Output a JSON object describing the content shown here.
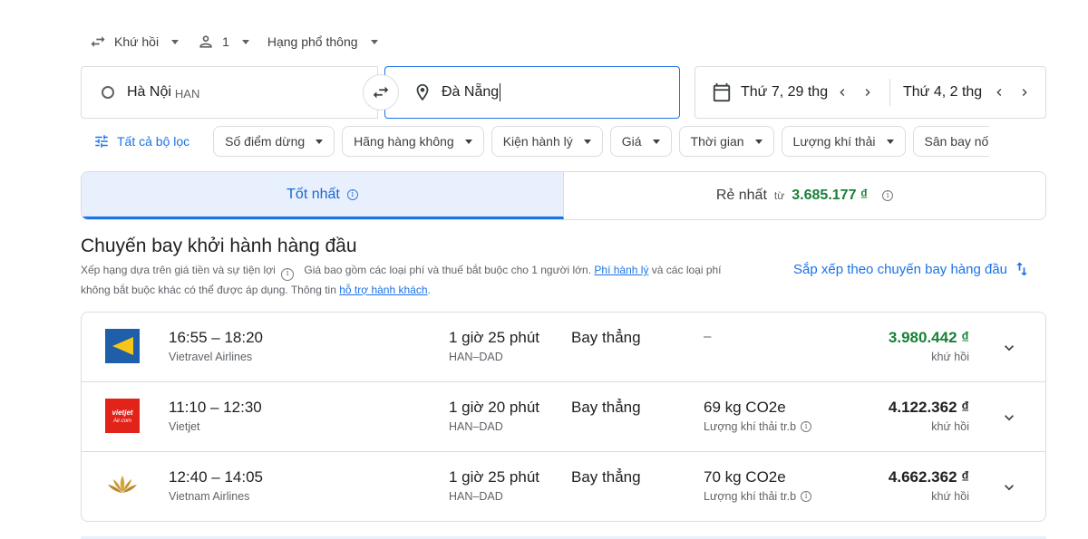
{
  "options": {
    "trip_type": "Khứ hồi",
    "passengers": "1",
    "cabin_class": "Hạng phổ thông"
  },
  "search": {
    "origin_city": "Hà Nội",
    "origin_code": "HAN",
    "destination": "Đà Nẵng",
    "depart_date": "Thứ 7, 29 thg",
    "return_date": "Thứ 4, 2 thg"
  },
  "filters": {
    "all_filters": "Tất cả bộ lọc",
    "chips": [
      "Số điểm dừng",
      "Hãng hàng không",
      "Kiện hành lý",
      "Giá",
      "Thời gian",
      "Lượng khí thải",
      "Sân bay nố"
    ]
  },
  "tabs": {
    "best": "Tốt nhất",
    "cheapest": "Rẻ nhất",
    "cheapest_from": "từ",
    "cheapest_price": "3.685.177 ₫"
  },
  "section": {
    "title": "Chuyến bay khởi hành hàng đầu",
    "desc_rank": "Xếp hạng dựa trên giá tiền và sự tiện lợi",
    "desc_price_pre": "Giá bao gồm các loại phí và thuế bắt buộc cho 1 người lớn.",
    "desc_link_baggage": "Phí hành lý",
    "desc_price_mid": "và các loại phí",
    "desc_line2": "không bắt buộc khác có thể được áp dụng. Thông tin",
    "desc_link_support": "hỗ trợ hành khách",
    "desc_end": ".",
    "sort_label": "Sắp xếp theo chuyến bay hàng đầu"
  },
  "flights": [
    {
      "times": "16:55 – 18:20",
      "airline": "Vietravel Airlines",
      "duration": "1 giờ 25 phút",
      "route": "HAN–DAD",
      "stops": "Bay thẳng",
      "emissions": "–",
      "emissions_note": "",
      "price": "3.980.442 ₫",
      "price_note": "khứ hồi",
      "price_color": "#188038"
    },
    {
      "times": "11:10 – 12:30",
      "airline": "Vietjet",
      "duration": "1 giờ 20 phút",
      "route": "HAN–DAD",
      "stops": "Bay thẳng",
      "emissions": "69 kg CO2e",
      "emissions_note": "Lượng khí thải tr.b",
      "price": "4.122.362 ₫",
      "price_note": "khứ hồi",
      "price_color": "#202124"
    },
    {
      "times": "12:40 – 14:05",
      "airline": "Vietnam Airlines",
      "duration": "1 giờ 25 phút",
      "route": "HAN–DAD",
      "stops": "Bay thẳng",
      "emissions": "70 kg CO2e",
      "emissions_note": "Lượng khí thải tr.b",
      "price": "4.662.362 ₫",
      "price_note": "khứ hồi",
      "price_color": "#202124"
    }
  ],
  "logo_vietjet_text": "vietjetAir.com"
}
